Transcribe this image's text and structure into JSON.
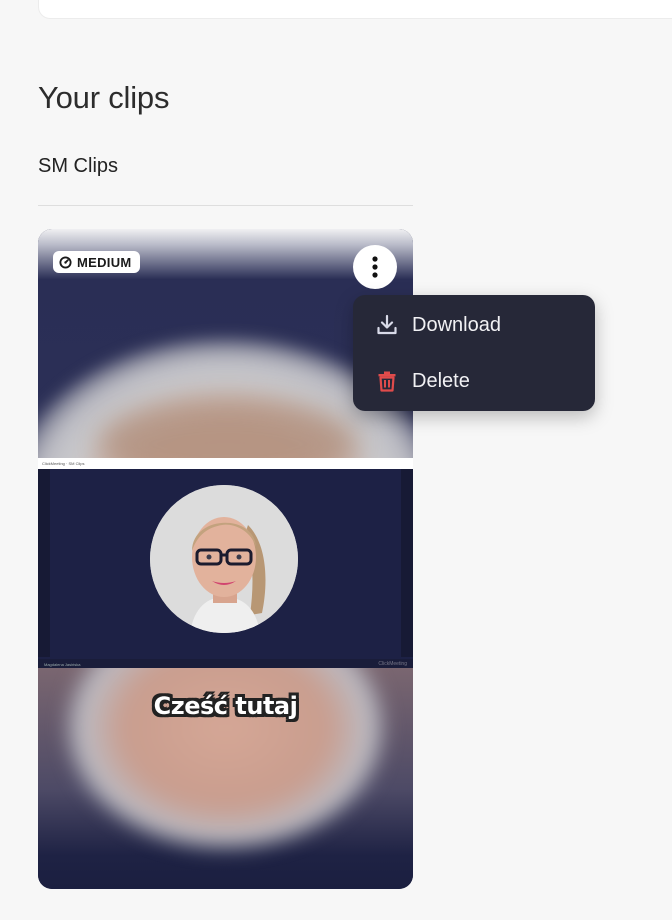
{
  "section": {
    "title": "Your clips"
  },
  "group": {
    "title": "SM Clips"
  },
  "clip": {
    "badge": {
      "label": "MEDIUM",
      "icon": "gauge-icon"
    },
    "more_icon": "more-vertical-icon",
    "caption": "Cześć tutaj",
    "video_header_text": "ClickMeeting · SM Clips",
    "video_footer_name": "Magdalena Jasińska",
    "video_footer_logo": "ClickMeeting"
  },
  "menu": {
    "items": [
      {
        "label": "Download",
        "icon": "download-icon",
        "color": "#d8dae8"
      },
      {
        "label": "Delete",
        "icon": "trash-icon",
        "color": "#e04b4b"
      }
    ]
  }
}
